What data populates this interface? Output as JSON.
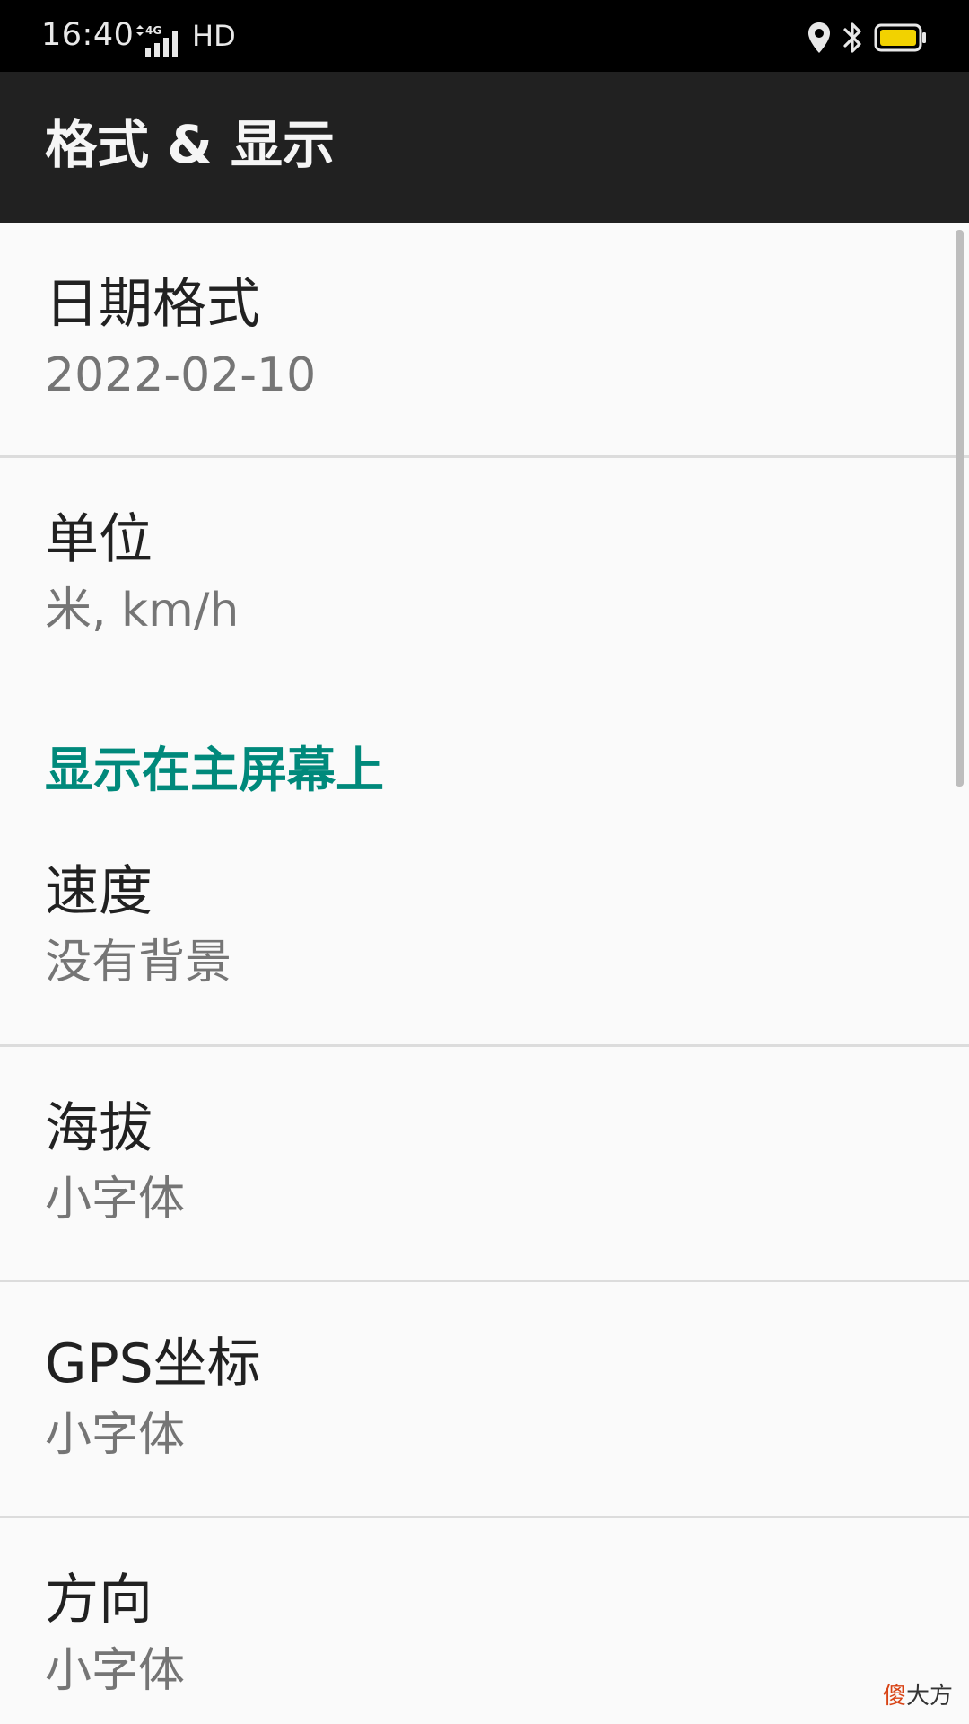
{
  "status_bar": {
    "time": "16:40",
    "network": "4G",
    "hd": "HD",
    "icons": [
      "location-icon",
      "bluetooth-icon",
      "battery-icon"
    ],
    "battery_color": "#f2d200"
  },
  "app_bar": {
    "title": "格式 & 显示"
  },
  "preferences": [
    {
      "title": "日期格式",
      "summary": "2022-02-10"
    },
    {
      "title": "单位",
      "summary": "米, km/h"
    }
  ],
  "section": {
    "title": "显示在主屏幕上",
    "color": "#00897b",
    "items": [
      {
        "title": "速度",
        "summary": "没有背景"
      },
      {
        "title": "海拔",
        "summary": "小字体"
      },
      {
        "title": "GPS坐标",
        "summary": "小字体"
      },
      {
        "title": "方向",
        "summary": "小字体"
      }
    ]
  },
  "watermark": {
    "accent": "傻",
    "rest": "大方"
  }
}
